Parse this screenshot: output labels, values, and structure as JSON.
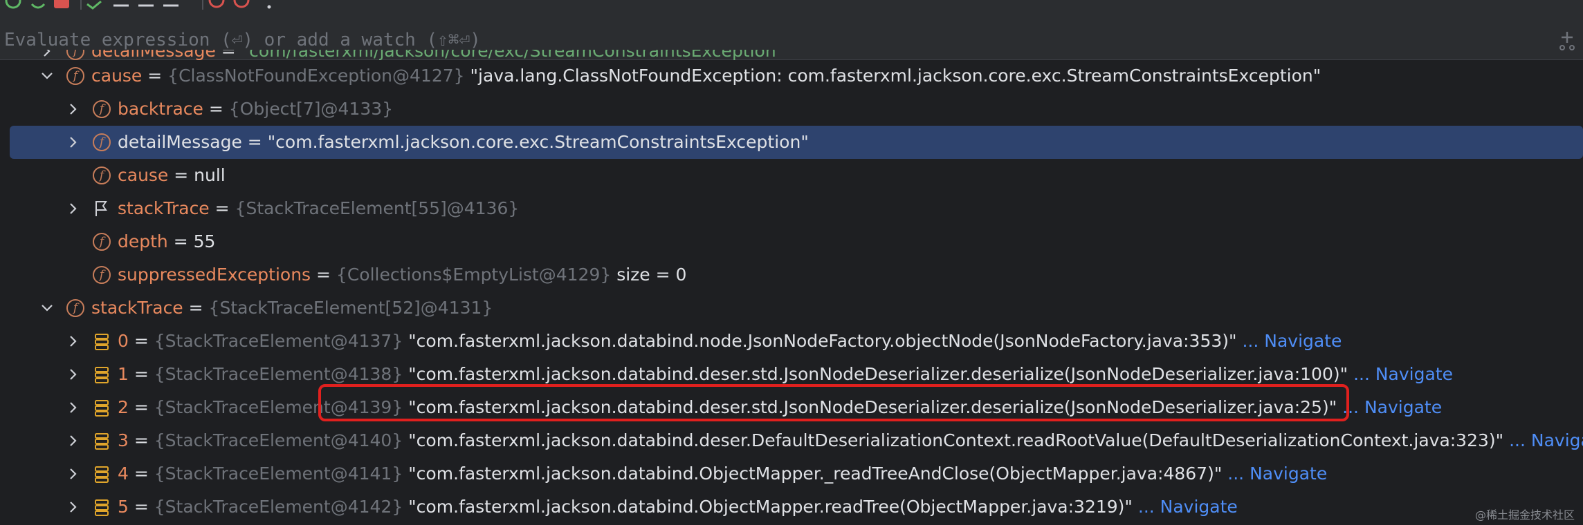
{
  "eval": {
    "placeholder": "Evaluate expression (⏎) or add a watch (⇧⌘⏎)"
  },
  "rows": [
    {
      "name": "detailMessage",
      "eq": " = ",
      "str": "\"com/fasterxml/jackson/core/exc/StreamConstraintsException\""
    },
    {
      "name": "cause",
      "eq": " = ",
      "type": "{ClassNotFoundException@4127}",
      "str": " \"java.lang.ClassNotFoundException: com.fasterxml.jackson.core.exc.StreamConstraintsException\""
    },
    {
      "name": "backtrace",
      "eq": " = ",
      "type": "{Object[7]@4133}"
    },
    {
      "name": "detailMessage",
      "eq": " = ",
      "str": "\"com.fasterxml.jackson.core.exc.StreamConstraintsException\""
    },
    {
      "name": "cause",
      "eq": " = ",
      "str": "null"
    },
    {
      "name": "stackTrace",
      "eq": " = ",
      "type": "{StackTraceElement[55]@4136}"
    },
    {
      "name": "depth",
      "eq": " = ",
      "str": "55"
    },
    {
      "name": "suppressedExceptions",
      "eq": " = ",
      "type": "{Collections$EmptyList@4129}",
      "str": "  size = 0"
    },
    {
      "name": "stackTrace",
      "eq": " = ",
      "type": "{StackTraceElement[52]@4131}"
    },
    {
      "name": "0",
      "eq": " = ",
      "type": "{StackTraceElement@4137}",
      "str": " \"com.fasterxml.jackson.databind.node.JsonNodeFactory.objectNode(JsonNodeFactory.java:353)\"",
      "nav": " ... Navigate"
    },
    {
      "name": "1",
      "eq": " = ",
      "type": "{StackTraceElement@4138}",
      "str": " \"com.fasterxml.jackson.databind.deser.std.JsonNodeDeserializer.deserialize(JsonNodeDeserializer.java:100)\"",
      "nav": " ... Navigate"
    },
    {
      "name": "2",
      "eq": " = ",
      "type": "{StackTraceElement@4139}",
      "str": " \"com.fasterxml.jackson.databind.deser.std.JsonNodeDeserializer.deserialize(JsonNodeDeserializer.java:25)\"",
      "nav": " ... Navigate"
    },
    {
      "name": "3",
      "eq": " = ",
      "type": "{StackTraceElement@4140}",
      "str": " \"com.fasterxml.jackson.databind.deser.DefaultDeserializationContext.readRootValue(DefaultDeserializationContext.java:323)\"",
      "nav": " ... Navigate"
    },
    {
      "name": "4",
      "eq": " = ",
      "type": "{StackTraceElement@4141}",
      "str": " \"com.fasterxml.jackson.databind.ObjectMapper._readTreeAndClose(ObjectMapper.java:4867)\"",
      "nav": " ... Navigate"
    },
    {
      "name": "5",
      "eq": " = ",
      "type": "{StackTraceElement@4142}",
      "str": " \"com.fasterxml.jackson.databind.ObjectMapper.readTree(ObjectMapper.java:3219)\"",
      "nav": " ... Navigate"
    }
  ],
  "watermark": "@稀土掘金技术社区",
  "colors": {
    "background": "#1e1f22",
    "selected": "#2e436e",
    "field": "#e8895e",
    "navigate": "#4f8ef7",
    "highlight": "#e0201e"
  }
}
